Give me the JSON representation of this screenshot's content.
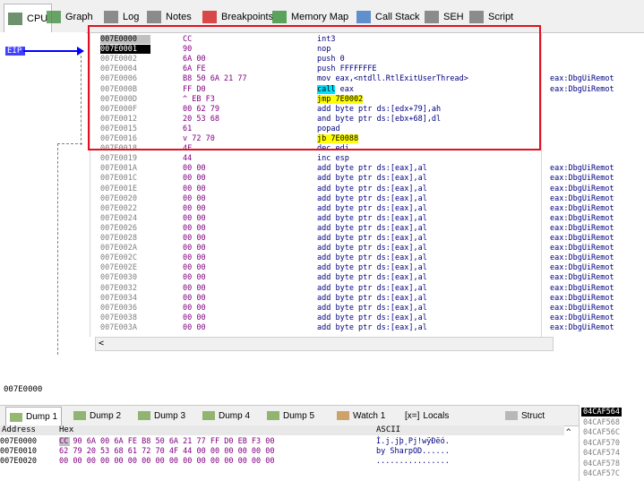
{
  "tabs": [
    {
      "label": "CPU",
      "icon": "cpu-icon",
      "color": "#3c6e3c"
    },
    {
      "label": "Graph",
      "icon": "graph-icon",
      "color": "#3a8a3a"
    },
    {
      "label": "Log",
      "icon": "log-icon",
      "color": "#6a6a6a"
    },
    {
      "label": "Notes",
      "icon": "notes-icon",
      "color": "#6a6a6a"
    },
    {
      "label": "Breakpoints",
      "icon": "breakpoint-icon",
      "color": "#d01010"
    },
    {
      "label": "Memory Map",
      "icon": "memory-map-icon",
      "color": "#2a8a2a"
    },
    {
      "label": "Call Stack",
      "icon": "call-stack-icon",
      "color": "#3070c0"
    },
    {
      "label": "SEH",
      "icon": "seh-icon",
      "color": "#6a6a6a"
    },
    {
      "label": "Script",
      "icon": "script-icon",
      "color": "#6a6a6a"
    }
  ],
  "ip_label": "EIP",
  "disasm": [
    {
      "addr": "007E0000",
      "bytes": "CC",
      "instr": "int3",
      "comment": "",
      "style": "hl"
    },
    {
      "addr": "007E0001",
      "bytes": "90",
      "instr": "nop",
      "comment": "",
      "style": "sel"
    },
    {
      "addr": "007E0002",
      "bytes": "6A 00",
      "instr": "push 0",
      "comment": ""
    },
    {
      "addr": "007E0004",
      "bytes": "6A FE",
      "instr": "push FFFFFFFE",
      "comment": ""
    },
    {
      "addr": "007E0006",
      "bytes": "B8 50 6A 21 77",
      "instr": "mov eax,<ntdll.RtlExitUserThread>",
      "comment": "eax:DbgUiRemot"
    },
    {
      "addr": "007E000B",
      "bytes": "FF D0",
      "instr_kw": "call",
      "instr_rest": " eax",
      "kwclass": "kw-call",
      "comment": "eax:DbgUiRemot"
    },
    {
      "addr": "007E000D",
      "bytes": "^ EB F3",
      "instr_kw": "jmp 7E0002",
      "instr_rest": "",
      "kwclass": "kw-jmp",
      "comment": ""
    },
    {
      "addr": "007E000F",
      "bytes": "00 62 79",
      "instr": "add byte ptr ds:[edx+79],ah",
      "comment": ""
    },
    {
      "addr": "007E0012",
      "bytes": "20 53 68",
      "instr": "and byte ptr ds:[ebx+68],dl",
      "comment": ""
    },
    {
      "addr": "007E0015",
      "bytes": "61",
      "instr": "popad",
      "comment": ""
    },
    {
      "addr": "007E0016",
      "bytes": "v 72 70",
      "instr_kw": "jb 7E0088",
      "instr_rest": "",
      "kwclass": "kw-jb",
      "comment": ""
    },
    {
      "addr": "007E0018",
      "bytes": "4F",
      "instr": "dec edi",
      "comment": ""
    },
    {
      "addr": "007E0019",
      "bytes": "44",
      "instr": "inc esp",
      "comment": ""
    },
    {
      "addr": "007E001A",
      "bytes": "00 00",
      "instr": "add byte ptr ds:[eax],al",
      "comment": "eax:DbgUiRemot"
    },
    {
      "addr": "007E001C",
      "bytes": "00 00",
      "instr": "add byte ptr ds:[eax],al",
      "comment": "eax:DbgUiRemot"
    },
    {
      "addr": "007E001E",
      "bytes": "00 00",
      "instr": "add byte ptr ds:[eax],al",
      "comment": "eax:DbgUiRemot"
    },
    {
      "addr": "007E0020",
      "bytes": "00 00",
      "instr": "add byte ptr ds:[eax],al",
      "comment": "eax:DbgUiRemot"
    },
    {
      "addr": "007E0022",
      "bytes": "00 00",
      "instr": "add byte ptr ds:[eax],al",
      "comment": "eax:DbgUiRemot"
    },
    {
      "addr": "007E0024",
      "bytes": "00 00",
      "instr": "add byte ptr ds:[eax],al",
      "comment": "eax:DbgUiRemot"
    },
    {
      "addr": "007E0026",
      "bytes": "00 00",
      "instr": "add byte ptr ds:[eax],al",
      "comment": "eax:DbgUiRemot"
    },
    {
      "addr": "007E0028",
      "bytes": "00 00",
      "instr": "add byte ptr ds:[eax],al",
      "comment": "eax:DbgUiRemot"
    },
    {
      "addr": "007E002A",
      "bytes": "00 00",
      "instr": "add byte ptr ds:[eax],al",
      "comment": "eax:DbgUiRemot"
    },
    {
      "addr": "007E002C",
      "bytes": "00 00",
      "instr": "add byte ptr ds:[eax],al",
      "comment": "eax:DbgUiRemot"
    },
    {
      "addr": "007E002E",
      "bytes": "00 00",
      "instr": "add byte ptr ds:[eax],al",
      "comment": "eax:DbgUiRemot"
    },
    {
      "addr": "007E0030",
      "bytes": "00 00",
      "instr": "add byte ptr ds:[eax],al",
      "comment": "eax:DbgUiRemot"
    },
    {
      "addr": "007E0032",
      "bytes": "00 00",
      "instr": "add byte ptr ds:[eax],al",
      "comment": "eax:DbgUiRemot"
    },
    {
      "addr": "007E0034",
      "bytes": "00 00",
      "instr": "add byte ptr ds:[eax],al",
      "comment": "eax:DbgUiRemot"
    },
    {
      "addr": "007E0036",
      "bytes": "00 00",
      "instr": "add byte ptr ds:[eax],al",
      "comment": "eax:DbgUiRemot"
    },
    {
      "addr": "007E0038",
      "bytes": "00 00",
      "instr": "add byte ptr ds:[eax],al",
      "comment": "eax:DbgUiRemot"
    },
    {
      "addr": "007E003A",
      "bytes": "00 00",
      "instr": "add byte ptr ds:[eax],al",
      "comment": "eax:DbgUiRemot"
    }
  ],
  "scroll_left": "<",
  "status_address": "007E0000",
  "dump_tabs": [
    {
      "label": "Dump 1"
    },
    {
      "label": "Dump 2"
    },
    {
      "label": "Dump 3"
    },
    {
      "label": "Dump 4"
    },
    {
      "label": "Dump 5"
    },
    {
      "label": "Watch 1"
    },
    {
      "label": "Locals",
      "prefix": "[x=]"
    },
    {
      "label": "Struct"
    }
  ],
  "dump_header": {
    "address": "Address",
    "hex": "Hex",
    "ascii": "ASCII"
  },
  "dump_rows": [
    {
      "addr": "007E0000",
      "hex": "CC 90 6A 00 6A FE B8 50 6A 21 77 FF D0 EB F3 00",
      "ascii": "Ì.j.jþ¸Pj!wÿÐëó."
    },
    {
      "addr": "007E0010",
      "hex": "62 79 20 53 68 61 72 70 4F 44 00 00 00 00 00 00",
      "ascii": "by SharpOD......"
    },
    {
      "addr": "007E0020",
      "hex": "00 00 00 00 00 00 00 00 00 00 00 00 00 00 00 00",
      "ascii": "................"
    }
  ],
  "stack": [
    "04CAF564",
    "04CAF568",
    "04CAF56C",
    "04CAF570",
    "04CAF574",
    "04CAF578",
    "04CAF57C"
  ]
}
